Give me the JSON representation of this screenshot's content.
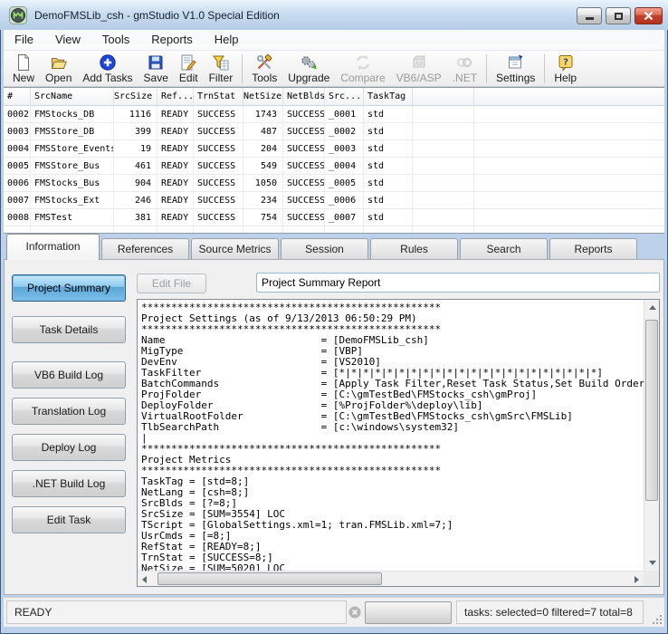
{
  "colors": {
    "frame_blue": "#bdd2ea",
    "accent_blue": "#5aa5d6",
    "close_red": "#ce4233"
  },
  "window": {
    "title": "DemoFMSLib_csh - gmStudio V1.0 Special Edition"
  },
  "menu": {
    "items": [
      "File",
      "View",
      "Tools",
      "Reports",
      "Help"
    ]
  },
  "toolbar": {
    "buttons": [
      {
        "label": "New",
        "enabled": true
      },
      {
        "label": "Open",
        "enabled": true
      },
      {
        "label": "Add Tasks",
        "enabled": true
      },
      {
        "label": "Save",
        "enabled": true
      },
      {
        "label": "Edit",
        "enabled": true
      },
      {
        "label": "Filter",
        "enabled": true
      },
      {
        "label": "Tools",
        "enabled": true
      },
      {
        "label": "Upgrade",
        "enabled": true
      },
      {
        "label": "Compare",
        "enabled": false
      },
      {
        "label": "VB6/ASP",
        "enabled": false
      },
      {
        "label": ".NET",
        "enabled": false
      },
      {
        "label": "Settings",
        "enabled": true
      },
      {
        "label": "Help",
        "enabled": true
      }
    ]
  },
  "grid": {
    "columns": [
      "#",
      "SrcName",
      "SrcSize",
      "Ref...",
      "TrnStat",
      "NetSize",
      "NetBlds",
      "Src...",
      "TaskTag"
    ],
    "rows": [
      [
        "0002",
        "FMStocks_DB",
        "1116",
        "READY",
        "SUCCESS",
        "1743",
        "SUCCESS",
        "_0001",
        "std"
      ],
      [
        "0003",
        "FMSStore_DB",
        "399",
        "READY",
        "SUCCESS",
        "487",
        "SUCCESS",
        "_0002",
        "std"
      ],
      [
        "0004",
        "FMSStore_Events",
        "19",
        "READY",
        "SUCCESS",
        "204",
        "SUCCESS",
        "_0003",
        "std"
      ],
      [
        "0005",
        "FMSStore_Bus",
        "461",
        "READY",
        "SUCCESS",
        "549",
        "SUCCESS",
        "_0004",
        "std"
      ],
      [
        "0006",
        "FMStocks_Bus",
        "904",
        "READY",
        "SUCCESS",
        "1050",
        "SUCCESS",
        "_0005",
        "std"
      ],
      [
        "0007",
        "FMStocks_Ext",
        "246",
        "READY",
        "SUCCESS",
        "234",
        "SUCCESS",
        "_0006",
        "std"
      ],
      [
        "0008",
        "FMSTest",
        "381",
        "READY",
        "SUCCESS",
        "754",
        "SUCCESS",
        "_0007",
        "std"
      ]
    ]
  },
  "tabs": {
    "active": "Information",
    "items": [
      "Information",
      "References",
      "Source Metrics",
      "Session",
      "Rules",
      "Search",
      "Reports"
    ]
  },
  "sidebar": {
    "active": "Project Summary",
    "items": [
      "Project Summary",
      "Task Details",
      "VB6 Build Log",
      "Translation Log",
      "Deploy Log",
      ".NET Build Log",
      "Edit Task"
    ]
  },
  "report": {
    "edit_file": "Edit File",
    "title": "Project Summary Report",
    "content": "**************************************************\nProject Settings (as of 9/13/2013 06:50:29 PM)\n**************************************************\nName                          = [DemoFMSLib_csh]\nMigType                       = [VBP]\nDevEnv                        = [VS2010]\nTaskFilter                    = [*|*|*|*|*|*|*|*|*|*|*|*|*|*|*|*|*|*|*|*|*|*]\nBatchCommands                 = [Apply Task Filter,Reset Task Status,Set Build Order,Au\nProjFolder                    = [C:\\gmTestBed\\FMStocks_csh\\gmProj]\nDeployFolder                  = [%ProjFolder%\\deploy\\lib]\nVirtualRootFolder             = [C:\\gmTestBed\\FMStocks_csh\\gmSrc\\FMSLib]\nTlbSearchPath                 = [c:\\windows\\system32]\n|\n**************************************************\nProject Metrics\n**************************************************\nTaskTag = [std=8;]\nNetLang = [csh=8;]\nSrcBlds = [?=8;]\nSrcSize = [SUM=3554] LOC\nTScript = [GlobalSettings.xml=1; tran.FMSLib.xml=7;]\nUsrCmds = [=8;]\nRefStat = [READY=8;]\nTrnStat = [SUCCESS=8;]\nNetSize = [SUM=5020] LOC"
  },
  "status": {
    "ready": "READY",
    "tasks": "tasks: selected=0 filtered=7 total=8"
  }
}
